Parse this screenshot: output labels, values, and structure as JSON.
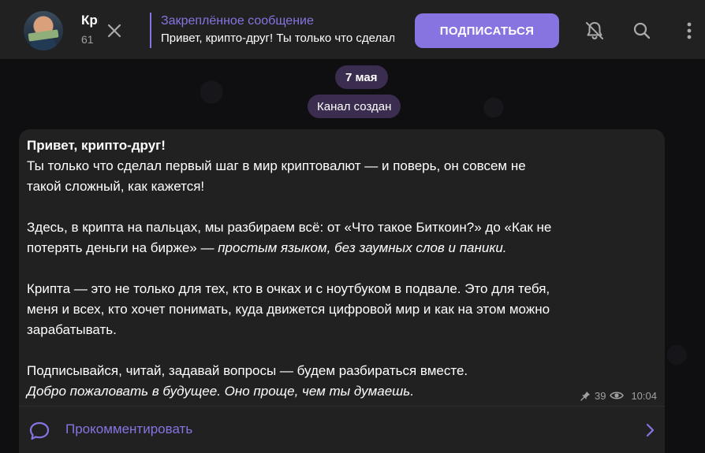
{
  "header": {
    "channel_name": "Крипта на пальцах",
    "subscribers": "61",
    "pinned_title": "Закреплённое сообщение",
    "pinned_text": "Привет, крипто-друг! Ты только что сделал первый шаг в мир криптовалют",
    "subscribe_label": "ПОДПИСАТЬСЯ",
    "icons": [
      "close-icon",
      "muted-bell-icon",
      "search-icon",
      "more-vertical-icon"
    ],
    "accent_color": "#8774e1"
  },
  "chat": {
    "date_label": "7 мая",
    "service_label": "Канал создан"
  },
  "message": {
    "line1_bold": "Привет, крипто-друг!",
    "line2": "Ты только что сделал первый шаг в мир криптовалют — и поверь, он совсем не",
    "line3": "такой сложный, как кажется!",
    "p2_line1": "Здесь, в крипта на пальцах, мы разбираем всё: от «Что такое Биткоин?» до «Как не",
    "p2_line2_plain": "потерять деньги на бирже» — ",
    "p2_line2_italic": "простым языком, без заумных слов и паники.",
    "p3_line1": "Крипта — это не только для тех, кто в очках и с ноутбуком в подвале. Это для тебя,",
    "p3_line2": "меня и всех, кто хочет понимать, куда движется цифровой мир и как на этом можно",
    "p3_line3": "зарабатывать.",
    "p4_line1": "Подписывайся, читай, задавай вопросы — будем разбираться вместе.",
    "p4_line2_italic": "Добро пожаловать в будущее. Оно проще, чем ты думаешь.",
    "views": "39",
    "time": "10:04",
    "comment_label": "Прокомментировать"
  }
}
